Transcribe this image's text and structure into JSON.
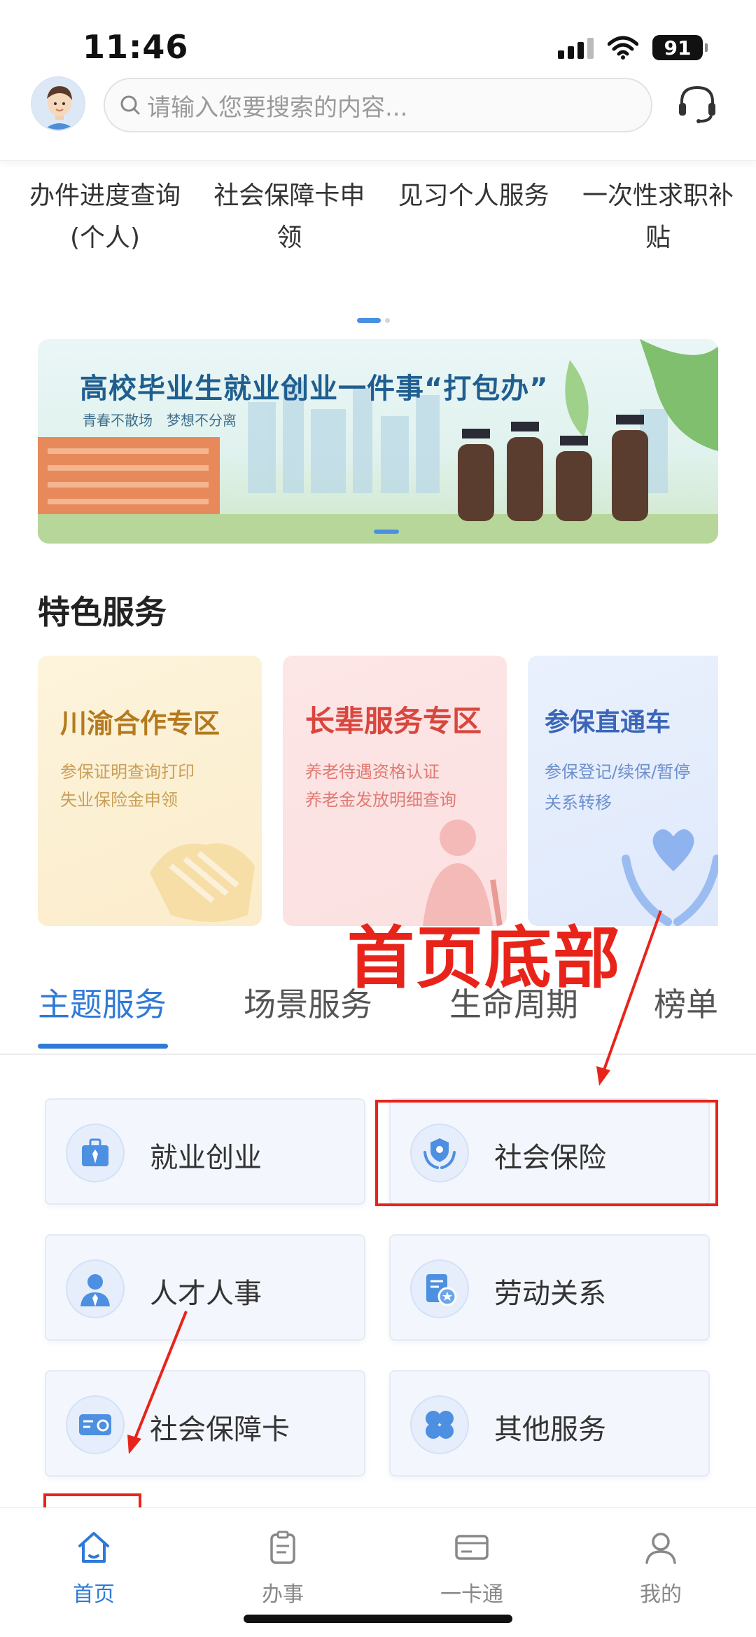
{
  "status": {
    "time": "11:46",
    "battery": "91"
  },
  "header": {
    "search_placeholder": "请输入您要搜索的内容..."
  },
  "quick_links": [
    {
      "label": "办件进度查询(个人)"
    },
    {
      "label": "社会保障卡申领"
    },
    {
      "label": "见习个人服务"
    },
    {
      "label": "一次性求职补贴"
    }
  ],
  "banner": {
    "title": "高校毕业生就业创业一件事“打包办”",
    "subtitle": "青春不散场　梦想不分离"
  },
  "featured": {
    "title": "特色服务",
    "cards": [
      {
        "title": "川渝合作专区",
        "lines": [
          "参保证明查询打印",
          "失业保险金申领"
        ]
      },
      {
        "title": "长辈服务专区",
        "lines": [
          "养老待遇资格认证",
          "养老金发放明细查询"
        ]
      },
      {
        "title": "参保直通车",
        "lines": [
          "参保登记/续保/暂停",
          "关系转移"
        ]
      }
    ]
  },
  "annotation": {
    "text": "首页底部"
  },
  "tabs": [
    {
      "label": "主题服务",
      "active": true
    },
    {
      "label": "场景服务"
    },
    {
      "label": "生命周期"
    },
    {
      "label": "榜单"
    }
  ],
  "grid": [
    {
      "label": "就业创业",
      "icon": "briefcase-icon"
    },
    {
      "label": "社会保险",
      "icon": "shield-hands-icon"
    },
    {
      "label": "人才人事",
      "icon": "person-tie-icon"
    },
    {
      "label": "劳动关系",
      "icon": "document-badge-icon"
    },
    {
      "label": "社会保障卡",
      "icon": "card-icon"
    },
    {
      "label": "其他服务",
      "icon": "clover-icon"
    }
  ],
  "bottom_nav": [
    {
      "label": "首页",
      "icon": "home-icon",
      "active": true
    },
    {
      "label": "办事",
      "icon": "clipboard-icon"
    },
    {
      "label": "一卡通",
      "icon": "card-icon"
    },
    {
      "label": "我的",
      "icon": "person-icon"
    }
  ],
  "colors": {
    "accent": "#2f7ad6",
    "annotation": "#e8241a"
  }
}
